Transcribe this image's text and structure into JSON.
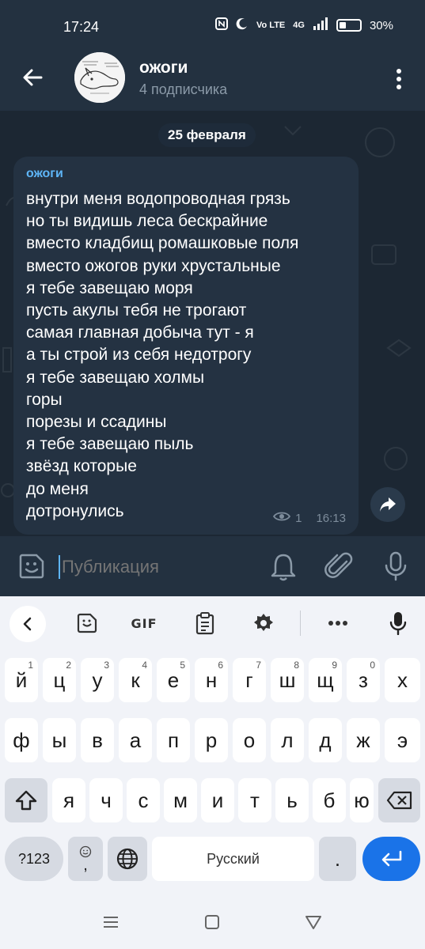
{
  "status_bar": {
    "time": "17:24",
    "network_label": "4G",
    "volte_label": "Vo LTE",
    "battery": "30%"
  },
  "header": {
    "channel_title": "ожоги",
    "subscribers": "4 подписчика"
  },
  "chat": {
    "date": "25 февраля",
    "message": {
      "author": "ожоги",
      "lines": [
        "внутри меня водопроводная грязь",
        "но ты видишь леса бескрайние",
        "вместо кладбищ ромашковые поля",
        "вместо ожогов руки хрустальные",
        "я тебе завещаю моря",
        "пусть акулы тебя не трогают",
        "самая главная добыча тут - я",
        "а ты строй из себя недотрогу",
        "я тебе завещаю холмы",
        "горы",
        "порезы и ссадины",
        "я тебе завещаю пыль",
        "звёзд которые",
        "до меня",
        "дотронулись"
      ],
      "views": "1",
      "time": "16:13"
    }
  },
  "input": {
    "placeholder": "Публикация"
  },
  "keyboard": {
    "toolbar": {
      "gif_label": "GIF"
    },
    "row1": [
      {
        "k": "й",
        "h": "1"
      },
      {
        "k": "ц",
        "h": "2"
      },
      {
        "k": "у",
        "h": "3"
      },
      {
        "k": "к",
        "h": "4"
      },
      {
        "k": "е",
        "h": "5"
      },
      {
        "k": "н",
        "h": "6"
      },
      {
        "k": "г",
        "h": "7"
      },
      {
        "k": "ш",
        "h": "8"
      },
      {
        "k": "щ",
        "h": "9"
      },
      {
        "k": "з",
        "h": "0"
      },
      {
        "k": "х",
        "h": ""
      }
    ],
    "row2": [
      "ф",
      "ы",
      "в",
      "а",
      "п",
      "р",
      "о",
      "л",
      "д",
      "ж",
      "э"
    ],
    "row3": [
      "я",
      "ч",
      "с",
      "м",
      "и",
      "т",
      "ь",
      "б",
      "ю"
    ],
    "symbols_label": "?123",
    "comma_label": ",",
    "space_label": "Русский",
    "period_label": "."
  },
  "colors": {
    "accent": "#5eb5f7",
    "background": "#1c2733",
    "bubble": "#243242",
    "enter": "#1a73e8"
  }
}
